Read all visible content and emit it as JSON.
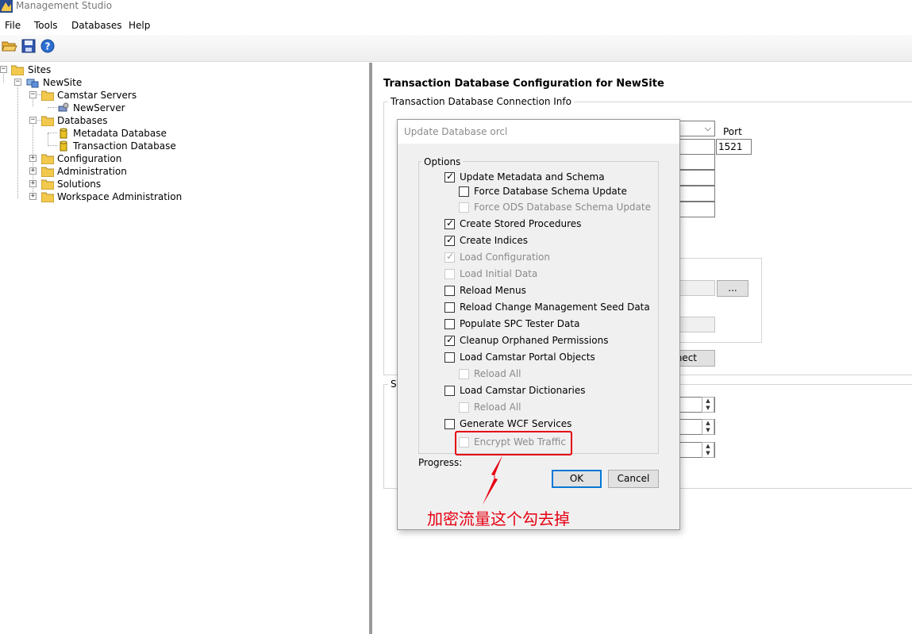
{
  "window": {
    "title": "Management Studio"
  },
  "menu": [
    "File",
    "Tools",
    "Databases",
    "Help"
  ],
  "toolbar": {
    "buttons": [
      "open-folder-icon",
      "save-icon",
      "help-icon"
    ]
  },
  "tree": {
    "sites": "Sites",
    "newsite": "NewSite",
    "camstar_servers": "Camstar Servers",
    "newserver": "NewServer",
    "databases": "Databases",
    "metadata_db": "Metadata Database",
    "transaction_db": "Transaction Database",
    "configuration": "Configuration",
    "administration": "Administration",
    "solutions": "Solutions",
    "workspace_admin": "Workspace Administration"
  },
  "content": {
    "title": "Transaction Database Configuration for NewSite",
    "conn_group": "Transaction Database Connection Info",
    "port_label": "Port",
    "port_value": "1521",
    "browse_label": "...",
    "connect_partial": "nect",
    "group2_partial": "Si"
  },
  "dialog": {
    "title": "Update Database orcl",
    "options_legend": "Options",
    "options": [
      {
        "label": "Update Metadata and Schema",
        "checked": true,
        "disabled": false
      },
      {
        "label": "Force Database Schema Update",
        "checked": false,
        "disabled": false
      },
      {
        "label": "Force ODS Database Schema Update",
        "checked": false,
        "disabled": true
      },
      {
        "label": "Create Stored Procedures",
        "checked": true,
        "disabled": false
      },
      {
        "label": "Create Indices",
        "checked": true,
        "disabled": false
      },
      {
        "label": "Load Configuration",
        "checked": true,
        "disabled": true
      },
      {
        "label": "Load Initial Data",
        "checked": false,
        "disabled": true
      },
      {
        "label": "Reload Menus",
        "checked": false,
        "disabled": false
      },
      {
        "label": "Reload Change Management Seed Data",
        "checked": false,
        "disabled": false
      },
      {
        "label": "Populate SPC Tester Data",
        "checked": false,
        "disabled": false
      },
      {
        "label": "Cleanup Orphaned Permissions",
        "checked": true,
        "disabled": false
      },
      {
        "label": "Load Camstar Portal Objects",
        "checked": false,
        "disabled": false
      },
      {
        "label": "Reload All",
        "checked": false,
        "disabled": true
      },
      {
        "label": "Load Camstar Dictionaries",
        "checked": false,
        "disabled": false
      },
      {
        "label": "Reload All",
        "checked": false,
        "disabled": true
      },
      {
        "label": "Generate WCF Services",
        "checked": false,
        "disabled": false
      },
      {
        "label": "Encrypt Web Traffic",
        "checked": false,
        "disabled": true
      }
    ],
    "progress_label": "Progress:",
    "ok_label": "OK",
    "cancel_label": "Cancel"
  },
  "annotation": {
    "text": "加密流量这个勾去掉",
    "color": "#e60012"
  }
}
